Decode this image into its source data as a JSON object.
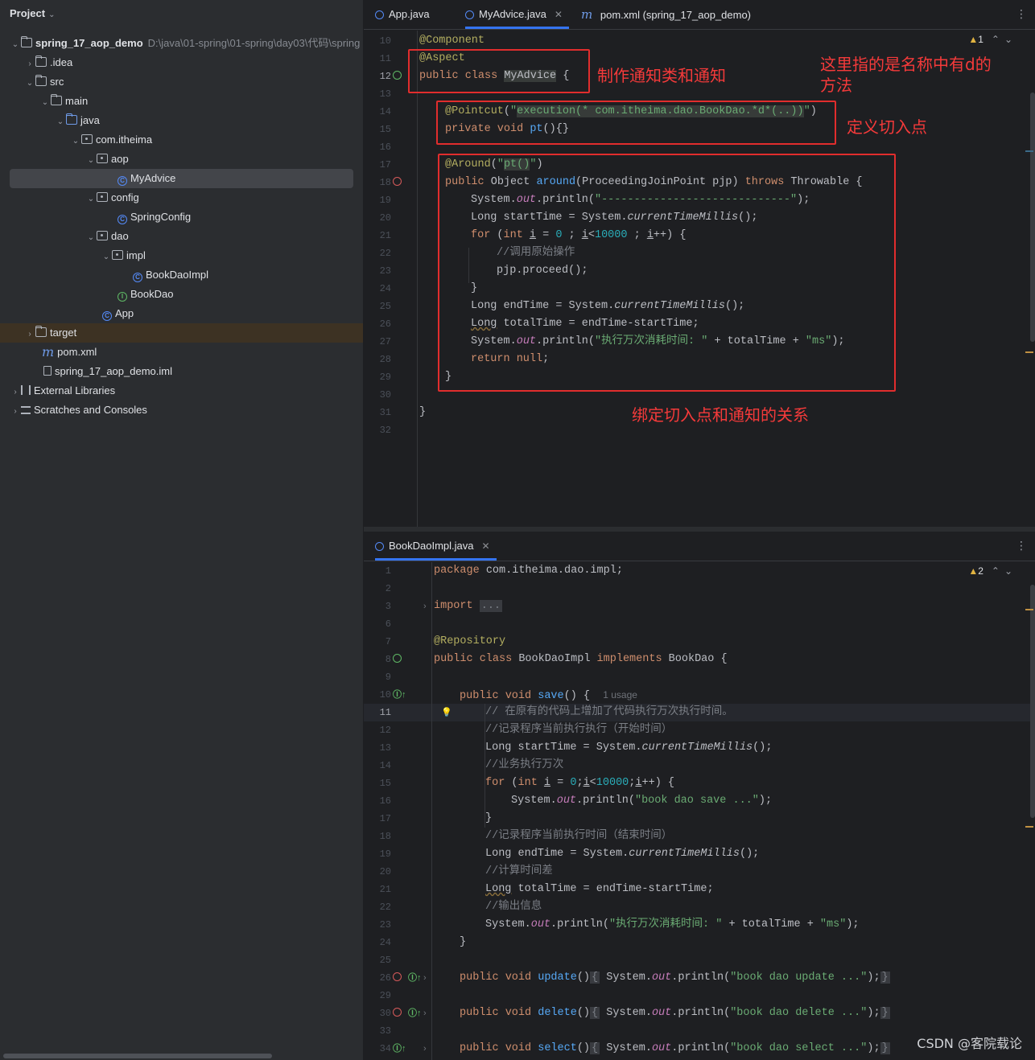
{
  "project": {
    "title": "Project",
    "title_chevron": "⌄",
    "root_name": "spring_17_aop_demo",
    "root_path": "D:\\java\\01-spring\\01-spring\\day03\\代码\\spring",
    "items": [
      {
        "label": ".idea"
      },
      {
        "label": "src"
      },
      {
        "label": "main"
      },
      {
        "label": "java"
      },
      {
        "label": "com.itheima"
      },
      {
        "label": "aop"
      },
      {
        "label": "MyAdvice"
      },
      {
        "label": "config"
      },
      {
        "label": "SpringConfig"
      },
      {
        "label": "dao"
      },
      {
        "label": "impl"
      },
      {
        "label": "BookDaoImpl"
      },
      {
        "label": "BookDao"
      },
      {
        "label": "App"
      },
      {
        "label": "target"
      },
      {
        "label": "pom.xml"
      },
      {
        "label": "spring_17_aop_demo.iml"
      },
      {
        "label": "External Libraries"
      },
      {
        "label": "Scratches and Consoles"
      }
    ]
  },
  "editor_top": {
    "tabs": [
      {
        "label": "App.java"
      },
      {
        "label": "MyAdvice.java"
      },
      {
        "label": "pom.xml (spring_17_aop_demo)"
      }
    ],
    "warning_count": "1",
    "line_numbers": [
      "10",
      "11",
      "12",
      "13",
      "14",
      "15",
      "16",
      "17",
      "18",
      "19",
      "20",
      "21",
      "22",
      "23",
      "24",
      "25",
      "26",
      "27",
      "28",
      "29",
      "30",
      "31",
      "32"
    ]
  },
  "editor_bottom": {
    "tabs": [
      {
        "label": "BookDaoImpl.java"
      }
    ],
    "warning_count": "2",
    "line_numbers": [
      "1",
      "2",
      "3",
      "6",
      "7",
      "8",
      "9",
      "10",
      "11",
      "12",
      "13",
      "14",
      "15",
      "16",
      "17",
      "18",
      "19",
      "20",
      "21",
      "22",
      "23",
      "24",
      "25",
      "26",
      "29",
      "30",
      "33",
      "34"
    ],
    "usage_hint": "1 usage"
  },
  "annotations": {
    "advice_class": "制作通知类和通知",
    "method_name_note": "这里指的是名称中有d的\n方法",
    "pointcut": "定义切入点",
    "binding": "绑定切入点和通知的关系"
  },
  "code_strings": {
    "pointcut_expr": "execution(* com.itheima.dao.BookDao.*d*(..))",
    "around_ref": "pt()",
    "divider": "-----------------------------",
    "elapsed_label": "执行万次消耗时间: ",
    "ms": "ms",
    "book_dao_save": "book dao save ...",
    "book_dao_update": "book dao update ...",
    "book_dao_delete": "book dao delete ...",
    "book_dao_select": "book dao select ..."
  },
  "watermark": "CSDN @客院载论",
  "colors": {
    "background": "#1e1f22",
    "panel": "#2b2d30",
    "keyword": "#cf8e6d",
    "annotation": "#b3ae60",
    "string": "#6aab73",
    "number": "#2aacb8",
    "function": "#56a8f5",
    "markup_red": "#e12d2d"
  }
}
